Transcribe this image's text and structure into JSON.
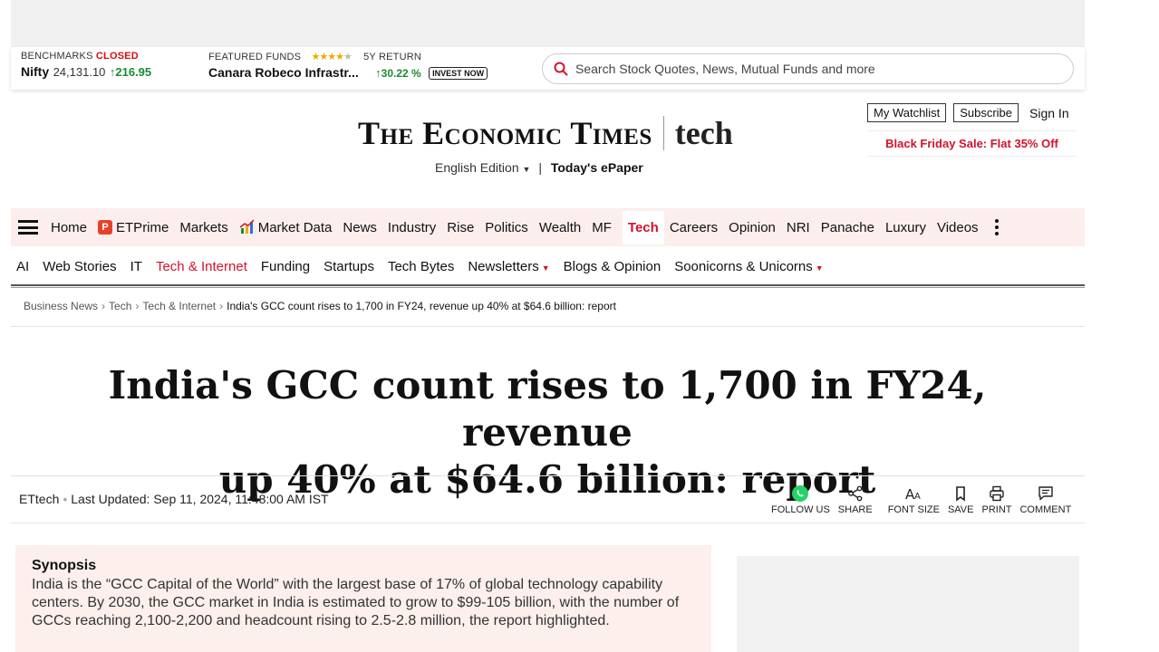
{
  "ticker": {
    "benchmarks_label": "BENCHMARKS",
    "status": "CLOSED",
    "index_name": "Nifty",
    "index_value": "24,131.10",
    "index_change": "216.95",
    "featured_label": "FEATURED FUNDS",
    "fund_rating": 4,
    "fund_name": "Canara Robeco Infrastr...",
    "return_label": "5Y RETURN",
    "return_value": "30.22 %",
    "invest_label": "INVEST NOW",
    "search_placeholder": "Search Stock Quotes, News, Mutual Funds and more"
  },
  "masthead": {
    "brand": "The Economic Times",
    "section_brand": "tech",
    "edition": "English Edition",
    "separator": "|",
    "epaper": "Today's ePaper",
    "watchlist": "My Watchlist",
    "subscribe": "Subscribe",
    "signin": "Sign In",
    "promo": "Black Friday Sale: Flat 35% Off"
  },
  "nav": {
    "items": [
      "Home",
      "ETPrime",
      "Markets",
      "Market Data",
      "News",
      "Industry",
      "Rise",
      "Politics",
      "Wealth",
      "MF",
      "Tech",
      "Careers",
      "Opinion",
      "NRI",
      "Panache",
      "Luxury",
      "Videos"
    ],
    "active": "Tech"
  },
  "subnav": {
    "items": [
      "AI",
      "Web Stories",
      "IT",
      "Tech & Internet",
      "Funding",
      "Startups",
      "Tech Bytes",
      "Newsletters",
      "Blogs & Opinion",
      "Soonicorns & Unicorns"
    ],
    "active": "Tech & Internet"
  },
  "breadcrumb": {
    "items": [
      "Business News",
      "Tech",
      "Tech & Internet"
    ],
    "current": "India's GCC count rises to 1,700 in FY24, revenue up 40% at $64.6 billion: report",
    "separator": "›"
  },
  "article": {
    "headline_line1": "India's GCC count rises to 1,700 in FY24, revenue",
    "headline_line2": "up 40% at $64.6 billion: report",
    "author": "ETtech",
    "updated": "Last Updated: Sep 11, 2024, 11:48:00 AM IST",
    "synopsis_title": "Synopsis",
    "synopsis_body": "India is the “GCC Capital of the World” with the largest base of 17% of global technology capability centers. By 2030, the GCC market in India is estimated to grow to $99-105 billion, with the number of GCCs reaching 2,100-2,200 and headcount rising to 2.5-2.8 million, the report highlighted."
  },
  "tools": {
    "follow": "FOLLOW US",
    "share": "SHARE",
    "font_size": "FONT SIZE",
    "save": "SAVE",
    "print": "PRINT",
    "comment": "COMMENT"
  },
  "colors": {
    "brand_red": "#d3122b",
    "positive_green": "#1a8b2f",
    "nav_bg": "#fdeeee",
    "synopsis_bg": "#fcefec",
    "whatsapp": "#25d366"
  }
}
